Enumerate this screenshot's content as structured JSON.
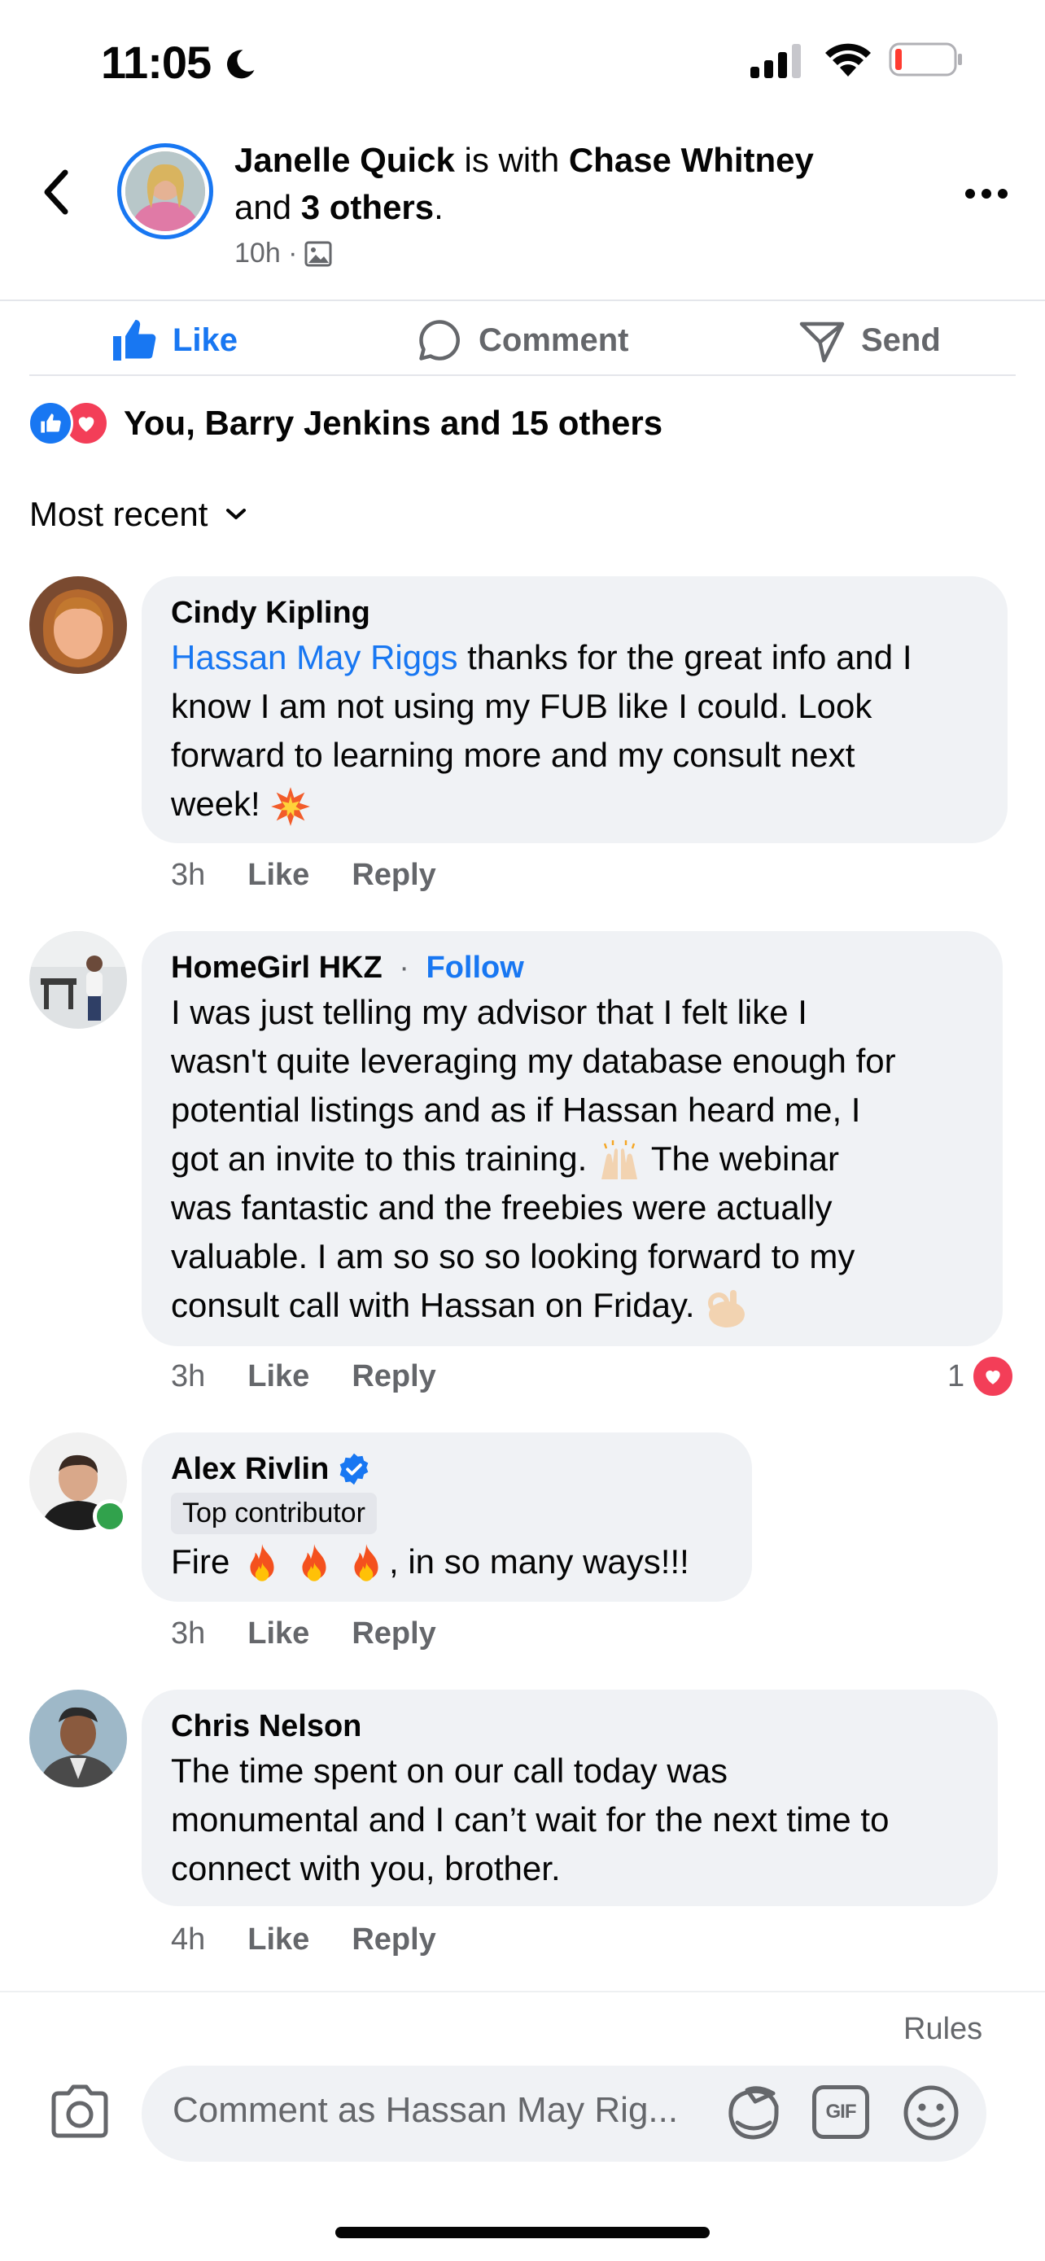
{
  "status_bar": {
    "time": "11:05"
  },
  "header": {
    "author": "Janelle Quick",
    "with_text": " is with ",
    "tagged": "Chase Whitney",
    "and_text": "and ",
    "others": "3 others",
    "period": ".",
    "time_ago": "10h ·"
  },
  "actions": {
    "like": "Like",
    "comment": "Comment",
    "send": "Send"
  },
  "reactions": {
    "summary": "You, Barry Jenkins and 15 others"
  },
  "sort": {
    "label": "Most recent"
  },
  "comments": [
    {
      "name": "Cindy Kipling",
      "mention": "Hassan May Riggs",
      "text_lines": [
        " thanks for the great info and I",
        "know I am not using my FUB like I could.  Look",
        "forward to learning more and my consult next",
        "week!"
      ],
      "time": "3h",
      "like": "Like",
      "reply": "Reply"
    },
    {
      "name": "HomeGirl HKZ",
      "separator": " · ",
      "follow": "Follow",
      "text_lines": [
        "I was just telling my advisor that I felt like I",
        "wasn't quite leveraging my database enough for",
        "potential listings and as if Hassan heard me, I",
        "got an invite to this training. ",
        " The webinar",
        "was fantastic and the freebies were actually",
        "valuable. I am so so so looking forward to my",
        "consult call with Hassan on Friday. "
      ],
      "time": "3h",
      "like": "Like",
      "reply": "Reply",
      "reaction_count": "1"
    },
    {
      "name": "Alex Rivlin",
      "badge": "Top contributor",
      "text_start": "Fire ",
      "text_end": ", in so many ways!!!",
      "time": "3h",
      "like": "Like",
      "reply": "Reply"
    },
    {
      "name": "Chris Nelson",
      "text_lines": [
        "The time spent on our call today was",
        "monumental and I can’t wait for the next time to",
        "connect with you, brother."
      ],
      "time": "4h",
      "like": "Like",
      "reply": "Reply"
    }
  ],
  "composer": {
    "rules": "Rules",
    "placeholder": "Comment as Hassan May Rig...",
    "gif": "GIF"
  },
  "colors": {
    "accent": "#1877f2",
    "love": "#f33e58",
    "bubble": "#f0f2f5",
    "online": "#31a24c"
  }
}
